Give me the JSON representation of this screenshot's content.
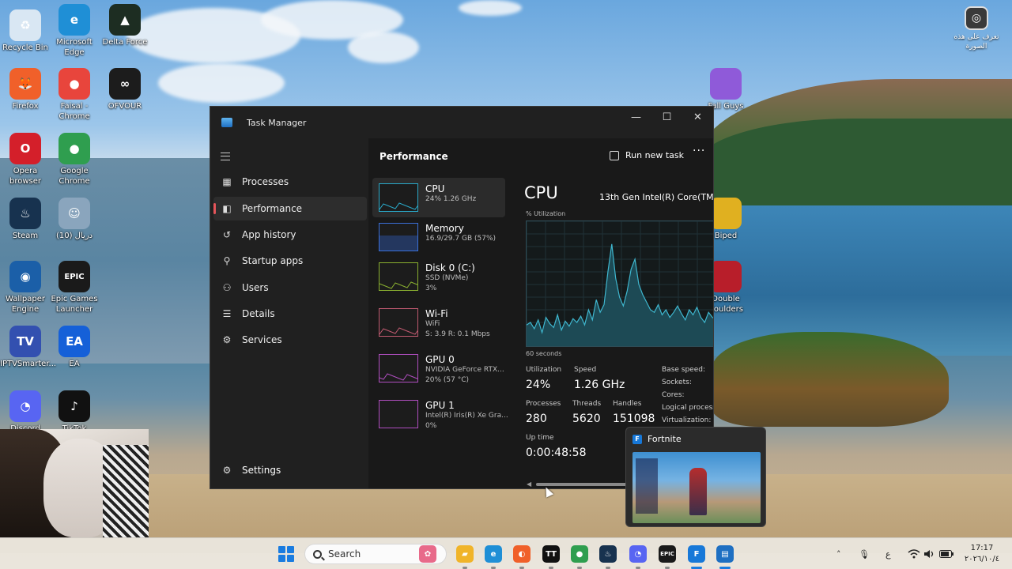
{
  "desktop": {
    "icons": [
      {
        "id": "recycle-bin",
        "label": "Recycle Bin",
        "color": "#d9e7f3",
        "glyph": "♻"
      },
      {
        "id": "edge",
        "label": "Microsoft Edge",
        "color": "#1f8fd6",
        "glyph": "e"
      },
      {
        "id": "delta-force",
        "label": "Delta Force",
        "color": "#1d2d22",
        "glyph": "▲"
      },
      {
        "id": "firefox",
        "label": "Firefox",
        "color": "#f0602a",
        "glyph": "🦊"
      },
      {
        "id": "faisal-chrome",
        "label": "Faisal - Chrome",
        "color": "#e8453c",
        "glyph": "●"
      },
      {
        "id": "ofvour",
        "label": "OFVOUR",
        "color": "#1c1c1c",
        "glyph": "∞"
      },
      {
        "id": "opera",
        "label": "Opera browser",
        "color": "#d41f2a",
        "glyph": "O"
      },
      {
        "id": "google-chrome",
        "label": "Google Chrome",
        "color": "#2f9e4f",
        "glyph": "●"
      },
      {
        "id": "steam",
        "label": "Steam",
        "color": "#17324f",
        "glyph": "♨"
      },
      {
        "id": "user-photo",
        "label": "(10) دريال",
        "color": "#8aa5bd",
        "glyph": "☺"
      },
      {
        "id": "wallpaper-engine",
        "label": "Wallpaper Engine",
        "color": "#1b5fa8",
        "glyph": "◉"
      },
      {
        "id": "epic-games",
        "label": "Epic Games Launcher",
        "color": "#1a1a1a",
        "glyph": "EPIC"
      },
      {
        "id": "iptv",
        "label": "IPTVSmarter...",
        "color": "#3350b0",
        "glyph": "TV"
      },
      {
        "id": "ea",
        "label": "EA",
        "color": "#1560d8",
        "glyph": "EA"
      },
      {
        "id": "discord",
        "label": "Discord",
        "color": "#5865f2",
        "glyph": "◔"
      },
      {
        "id": "tiktok",
        "label": "TikTok",
        "color": "#111",
        "glyph": "♪"
      }
    ],
    "top_right_label": "تعرف على هذه الصورة",
    "right_icons": [
      {
        "id": "fall-guys",
        "label": "Fall Guys",
        "color": "#8f5ad9"
      },
      {
        "id": "biped",
        "label": "Biped",
        "color": "#e0b020"
      },
      {
        "id": "double-boulders",
        "label": "Double Boulders",
        "color": "#b81e2a"
      }
    ]
  },
  "task_manager": {
    "title": "Task Manager",
    "window_controls": {
      "minimize": "—",
      "maximize": "☐",
      "close": "✕"
    },
    "nav": [
      {
        "id": "processes",
        "label": "Processes",
        "icon": "processes-icon",
        "glyph": "▦"
      },
      {
        "id": "performance",
        "label": "Performance",
        "icon": "performance-icon",
        "glyph": "◧",
        "active": true
      },
      {
        "id": "app-history",
        "label": "App history",
        "icon": "history-icon",
        "glyph": "↺"
      },
      {
        "id": "startup-apps",
        "label": "Startup apps",
        "icon": "startup-icon",
        "glyph": "⚲"
      },
      {
        "id": "users",
        "label": "Users",
        "icon": "users-icon",
        "glyph": "⚇"
      },
      {
        "id": "details",
        "label": "Details",
        "icon": "details-icon",
        "glyph": "☰"
      },
      {
        "id": "services",
        "label": "Services",
        "icon": "services-icon",
        "glyph": "⚙"
      }
    ],
    "settings_label": "Settings",
    "header": {
      "title": "Performance",
      "run_new_task": "Run new task",
      "more": "···"
    },
    "resources": [
      {
        "id": "cpu",
        "name": "CPU",
        "sub1": "24%  1.26 GHz",
        "sub2": "",
        "sub3": "",
        "accent": "#2aa9c9",
        "active": true
      },
      {
        "id": "memory",
        "name": "Memory",
        "sub1": "16.9/29.7 GB (57%)",
        "sub2": "",
        "sub3": "",
        "accent": "#3a6fd8"
      },
      {
        "id": "disk",
        "name": "Disk 0 (C:)",
        "sub1": "SSD (NVMe)",
        "sub2": "3%",
        "sub3": "",
        "accent": "#8ab030"
      },
      {
        "id": "wifi",
        "name": "Wi-Fi",
        "sub1": "WiFi",
        "sub2": "S: 3.9  R: 0.1 Mbps",
        "sub3": "",
        "accent": "#c05a70"
      },
      {
        "id": "gpu0",
        "name": "GPU 0",
        "sub1": "NVIDIA GeForce RTX...",
        "sub2": "20%  (57 °C)",
        "sub3": "",
        "accent": "#b04ec0"
      },
      {
        "id": "gpu1",
        "name": "GPU 1",
        "sub1": "Intel(R) Iris(R) Xe Gra...",
        "sub2": "0%",
        "sub3": "",
        "accent": "#b04ec0"
      }
    ],
    "cpu_detail": {
      "title": "CPU",
      "model": "13th Gen Intel(R) Core(TM",
      "util_axis_label": "% Utilization",
      "time_axis_label": "60 seconds",
      "utilization_label": "Utilization",
      "utilization_value": "24%",
      "speed_label": "Speed",
      "speed_value": "1.26 GHz",
      "processes_label": "Processes",
      "processes_value": "280",
      "threads_label": "Threads",
      "threads_value": "5620",
      "handles_label": "Handles",
      "handles_value": "151098",
      "uptime_label": "Up time",
      "uptime_value": "0:00:48:58",
      "side_labels": [
        "Base speed:",
        "Sockets:",
        "Cores:",
        "Logical process",
        "Virtualization:"
      ],
      "history": [
        18,
        20,
        15,
        22,
        12,
        24,
        19,
        16,
        26,
        14,
        21,
        17,
        23,
        20,
        25,
        18,
        30,
        22,
        38,
        28,
        34,
        60,
        82,
        55,
        40,
        33,
        45,
        62,
        70,
        50,
        42,
        36,
        30,
        28,
        34,
        26,
        30,
        24,
        28,
        33,
        27,
        22,
        30,
        26,
        32,
        24,
        20,
        28,
        24,
        22
      ]
    }
  },
  "preview": {
    "title": "Fortnite"
  },
  "taskbar": {
    "search_placeholder": "Search",
    "apps": [
      {
        "id": "widgets",
        "color": "#e86a8a",
        "glyph": "✿"
      },
      {
        "id": "file-explorer",
        "color": "#f0b429",
        "glyph": "▰"
      },
      {
        "id": "edge",
        "color": "#1f8fd6",
        "glyph": "e"
      },
      {
        "id": "firefox",
        "color": "#f0602a",
        "glyph": "◐"
      },
      {
        "id": "capcut",
        "color": "#111",
        "glyph": "TT"
      },
      {
        "id": "chrome",
        "color": "#2f9e4f",
        "glyph": "●"
      },
      {
        "id": "steam",
        "color": "#17324f",
        "glyph": "♨"
      },
      {
        "id": "discord",
        "color": "#5865f2",
        "glyph": "◔"
      },
      {
        "id": "epic",
        "color": "#1a1a1a",
        "glyph": "EPIC"
      },
      {
        "id": "fortnite",
        "color": "#1778d8",
        "glyph": "F"
      },
      {
        "id": "task-manager",
        "color": "#1e6fc2",
        "glyph": "▤"
      }
    ],
    "tray": {
      "chevron": "˄",
      "mic": "🎙",
      "lang": "ع",
      "clock_time": "17:17",
      "clock_date": "٢٠٢٦/١٠/٤"
    }
  }
}
